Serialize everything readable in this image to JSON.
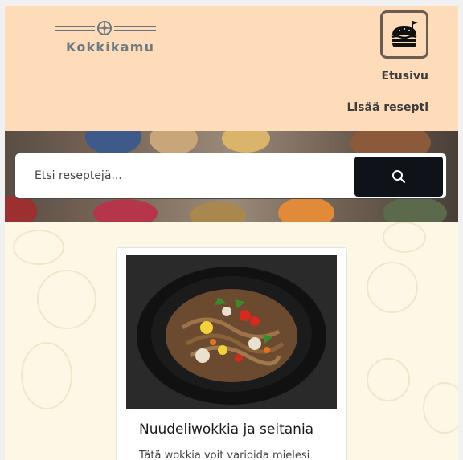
{
  "header": {
    "logo_text": "Kokkikamu",
    "menu_icon": "burger-icon",
    "nav": [
      {
        "label": "Etusivu"
      },
      {
        "label": "Lisää resepti"
      }
    ]
  },
  "search": {
    "placeholder": "Etsi reseptejä...",
    "value": "",
    "button_icon": "search-icon"
  },
  "recipes": [
    {
      "title": "Nuudeliwokkia ja seitania",
      "description": "Tätä wokkia voit varioida mielesi"
    }
  ],
  "colors": {
    "header_bg": "#ffdcb9",
    "search_button_bg": "#0f1218",
    "content_bg": "#fdf8e6",
    "nav_text": "#3d3d3d",
    "logo_text": "#6f7b83"
  }
}
